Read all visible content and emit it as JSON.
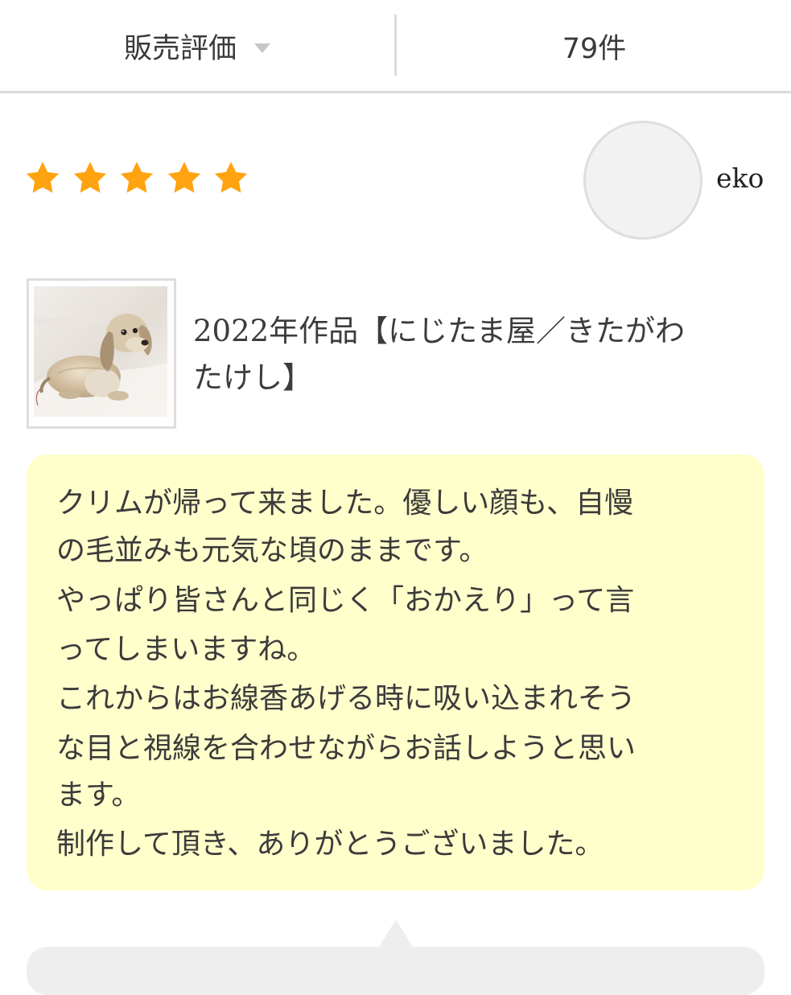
{
  "header": {
    "sort_label": "販売評価",
    "count_label": "79件"
  },
  "review": {
    "rating": 5,
    "rating_max": 5,
    "star_color": "#ffa310",
    "username": "eko",
    "product_title_lines": [
      "2022年作品【にじたま屋／きたがわ",
      "たけし】"
    ],
    "text_lines": [
      "クリムが帰って来ました。優しい顔も、自慢",
      "の毛並みも元気な頃のままです。",
      "やっぱり皆さんと同じく「おかえり」って言",
      "ってしまいますね。",
      "これからはお線香あげる時に吸い込まれそう",
      "な目と視線を合わせながらお話しようと思い",
      "ます。",
      "制作して頂き、ありがとうございました。"
    ]
  },
  "colors": {
    "bubble_bg": "#ffffcc",
    "reply_bg": "#eeeeee",
    "divider": "#dcdcdc"
  }
}
